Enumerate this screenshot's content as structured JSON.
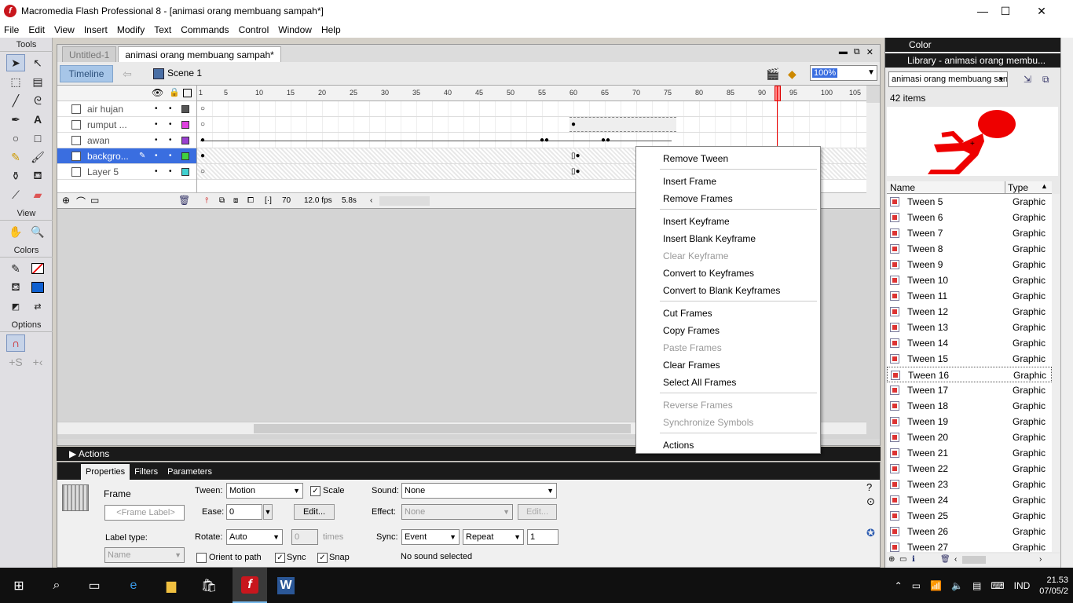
{
  "window": {
    "title": "Macromedia Flash Professional 8 - [animasi orang membuang sampah*]",
    "minimize": "—",
    "maximize": "☐",
    "close": "✕"
  },
  "menu": [
    "File",
    "Edit",
    "View",
    "Insert",
    "Modify",
    "Text",
    "Commands",
    "Control",
    "Window",
    "Help"
  ],
  "tools": {
    "title": "Tools",
    "view_title": "View",
    "colors_title": "Colors",
    "options_title": "Options"
  },
  "document": {
    "tabs": [
      "Untitled-1",
      "animasi orang membuang sampah*"
    ],
    "timeline_label": "Timeline",
    "scene": "Scene 1",
    "zoom": "100%"
  },
  "layers": [
    {
      "name": "air hujan",
      "color": "#555555"
    },
    {
      "name": "rumput ...",
      "color": "#e040e0"
    },
    {
      "name": "awan",
      "color": "#9a40d0"
    },
    {
      "name": "backgro...",
      "color": "#40d040"
    },
    {
      "name": "Layer 5",
      "color": "#40d0d0"
    }
  ],
  "ruler": [
    "1",
    "5",
    "10",
    "15",
    "20",
    "25",
    "30",
    "35",
    "40",
    "45",
    "50",
    "55",
    "60",
    "65",
    "70",
    "75",
    "80",
    "85",
    "90",
    "95",
    "100",
    "105"
  ],
  "frame_status": {
    "frame": "70",
    "fps": "12.0 fps",
    "time": "5.8s"
  },
  "context_menu": [
    {
      "label": "Remove Tween",
      "enabled": true
    },
    {
      "label": "Insert Frame",
      "enabled": true
    },
    {
      "label": "Remove Frames",
      "enabled": true
    },
    {
      "label": "Insert Keyframe",
      "enabled": true
    },
    {
      "label": "Insert Blank Keyframe",
      "enabled": true
    },
    {
      "label": "Clear Keyframe",
      "enabled": false
    },
    {
      "label": "Convert to Keyframes",
      "enabled": true
    },
    {
      "label": "Convert to Blank Keyframes",
      "enabled": true
    },
    {
      "label": "Cut Frames",
      "enabled": true
    },
    {
      "label": "Copy Frames",
      "enabled": true
    },
    {
      "label": "Paste Frames",
      "enabled": false
    },
    {
      "label": "Clear Frames",
      "enabled": true
    },
    {
      "label": "Select All Frames",
      "enabled": true
    },
    {
      "label": "Reverse Frames",
      "enabled": false
    },
    {
      "label": "Synchronize Symbols",
      "enabled": false
    },
    {
      "label": "Actions",
      "enabled": true
    }
  ],
  "actions_panel": "Actions",
  "properties": {
    "tabs": [
      "Properties",
      "Filters",
      "Parameters"
    ],
    "frame_label": "Frame",
    "frame_placeholder": "<Frame Label>",
    "label_type": "Label type:",
    "label_type_value": "Name",
    "tween": "Tween:",
    "tween_value": "Motion",
    "scale": "Scale",
    "ease": "Ease:",
    "ease_value": "0",
    "edit": "Edit...",
    "rotate": "Rotate:",
    "rotate_value": "Auto",
    "rotate_times": "0",
    "times": "times",
    "orient": "Orient to path",
    "sync_cb": "Sync",
    "snap": "Snap",
    "sound": "Sound:",
    "sound_value": "None",
    "effect": "Effect:",
    "effect_value": "None",
    "effect_edit": "Edit...",
    "sync": "Sync:",
    "sync_value": "Event",
    "repeat_value": "Repeat",
    "repeat_count": "1",
    "no_sound": "No sound selected"
  },
  "color_panel": "Color",
  "library": {
    "title": "Library - animasi orang membu...",
    "selector": "animasi orang membuang san",
    "count": "42 items",
    "col_name": "Name",
    "col_type": "Type",
    "items": [
      {
        "name": "Tween 5",
        "type": "Graphic"
      },
      {
        "name": "Tween 6",
        "type": "Graphic"
      },
      {
        "name": "Tween 7",
        "type": "Graphic"
      },
      {
        "name": "Tween 8",
        "type": "Graphic"
      },
      {
        "name": "Tween 9",
        "type": "Graphic"
      },
      {
        "name": "Tween 10",
        "type": "Graphic"
      },
      {
        "name": "Tween 11",
        "type": "Graphic"
      },
      {
        "name": "Tween 12",
        "type": "Graphic"
      },
      {
        "name": "Tween 13",
        "type": "Graphic"
      },
      {
        "name": "Tween 14",
        "type": "Graphic"
      },
      {
        "name": "Tween 15",
        "type": "Graphic"
      },
      {
        "name": "Tween 16",
        "type": "Graphic"
      },
      {
        "name": "Tween 17",
        "type": "Graphic"
      },
      {
        "name": "Tween 18",
        "type": "Graphic"
      },
      {
        "name": "Tween 19",
        "type": "Graphic"
      },
      {
        "name": "Tween 20",
        "type": "Graphic"
      },
      {
        "name": "Tween 21",
        "type": "Graphic"
      },
      {
        "name": "Tween 22",
        "type": "Graphic"
      },
      {
        "name": "Tween 23",
        "type": "Graphic"
      },
      {
        "name": "Tween 24",
        "type": "Graphic"
      },
      {
        "name": "Tween 25",
        "type": "Graphic"
      },
      {
        "name": "Tween 26",
        "type": "Graphic"
      },
      {
        "name": "Tween 27",
        "type": "Graphic"
      }
    ]
  },
  "taskbar": {
    "lang": "IND",
    "time": "21.53",
    "date": "07/05/2"
  }
}
